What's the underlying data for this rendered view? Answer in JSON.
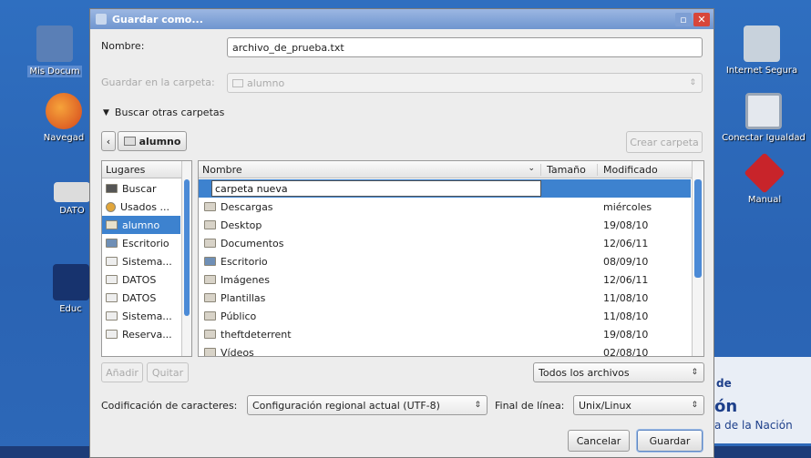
{
  "desktop": {
    "icons_left": [
      {
        "label": "Mis Docum"
      },
      {
        "label": "Navegad"
      },
      {
        "label": "DATO"
      },
      {
        "label": "Educ"
      }
    ],
    "icons_right": [
      {
        "label": "Internet Segura"
      },
      {
        "label": "Conectar Igualdad"
      },
      {
        "label": "Manual"
      }
    ],
    "banner": {
      "line1": "de",
      "line2": "ón",
      "line3": "a de la Nación"
    }
  },
  "dialog": {
    "title": "Guardar como...",
    "name_label": "Nombre:",
    "name_value": "archivo_de_prueba.txt",
    "save_in_label": "Guardar en la carpeta:",
    "save_in_value": "alumno",
    "browse_label": "Buscar otras carpetas",
    "path_back": "‹",
    "path_current": "alumno",
    "create_folder": "Crear carpeta",
    "places": {
      "header": "Lugares",
      "items": [
        {
          "label": "Buscar",
          "icon": "binoculars-icon"
        },
        {
          "label": "Usados ...",
          "icon": "clock-icon"
        },
        {
          "label": "alumno",
          "icon": "home-icon",
          "selected": true
        },
        {
          "label": "Escritorio",
          "icon": "desktop-icon"
        },
        {
          "label": "Sistema...",
          "icon": "drive-icon"
        },
        {
          "label": "DATOS",
          "icon": "drive-icon"
        },
        {
          "label": "DATOS",
          "icon": "drive-icon"
        },
        {
          "label": "Sistema...",
          "icon": "drive-icon"
        },
        {
          "label": "Reserva...",
          "icon": "drive-icon"
        }
      ]
    },
    "files": {
      "col_name": "Nombre",
      "col_size": "Tamaño",
      "col_modified": "Modificado",
      "new_folder_value": "carpeta nueva",
      "rows": [
        {
          "name": "Descargas",
          "modified": "miércoles"
        },
        {
          "name": "Desktop",
          "modified": "19/08/10"
        },
        {
          "name": "Documentos",
          "modified": "12/06/11"
        },
        {
          "name": "Escritorio",
          "modified": "08/09/10"
        },
        {
          "name": "Imágenes",
          "modified": "12/06/11"
        },
        {
          "name": "Plantillas",
          "modified": "11/08/10"
        },
        {
          "name": "Público",
          "modified": "11/08/10"
        },
        {
          "name": "theftdeterrent",
          "modified": "19/08/10"
        },
        {
          "name": "Vídeos",
          "modified": "02/08/10"
        }
      ]
    },
    "add_btn": "Añadir",
    "remove_btn": "Quitar",
    "filter_value": "Todos los archivos",
    "encoding_label": "Codificación de caracteres:",
    "encoding_value": "Configuración regional actual (UTF-8)",
    "line_end_label": "Final de línea:",
    "line_end_value": "Unix/Linux",
    "cancel_btn": "Cancelar",
    "save_btn": "Guardar"
  },
  "colors": {
    "selection": "#3d82cf",
    "desktop": "#2f6fc0",
    "close": "#d8463a"
  }
}
